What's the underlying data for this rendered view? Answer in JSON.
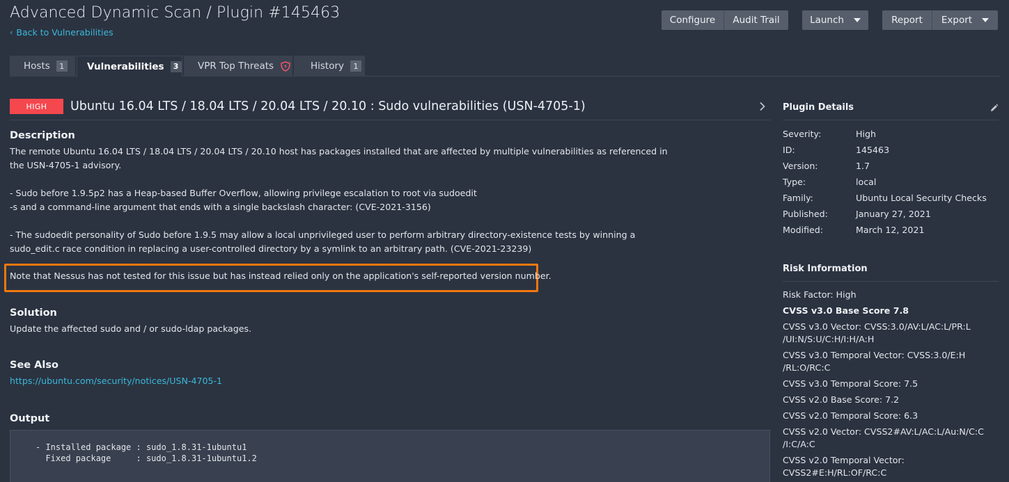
{
  "header": {
    "title": "Advanced Dynamic Scan / Plugin #145463",
    "back_label": "Back to Vulnerabilities"
  },
  "toolbar": {
    "configure": "Configure",
    "audit_trail": "Audit Trail",
    "launch": "Launch",
    "report": "Report",
    "export": "Export"
  },
  "tabs": [
    {
      "label": "Hosts",
      "count": "1"
    },
    {
      "label": "Vulnerabilities",
      "count": "3"
    },
    {
      "label": "VPR Top Threats"
    },
    {
      "label": "History",
      "count": "1"
    }
  ],
  "plugin": {
    "severity": "HIGH",
    "title": "Ubuntu 16.04 LTS / 18.04 LTS / 20.04 LTS / 20.10 : Sudo vulnerabilities (USN-4705-1)"
  },
  "description": {
    "heading": "Description",
    "p1_l1": "The remote Ubuntu 16.04 LTS / 18.04 LTS / 20.04 LTS / 20.10 host has packages installed that are affected by multiple vulnerabilities as referenced in",
    "p1_l2": "the USN-4705-1 advisory.",
    "p2_l1": "- Sudo before 1.9.5p2 has a Heap-based Buffer Overflow, allowing privilege escalation to root via sudoedit",
    "p2_l2": "-s and a command-line argument that ends with a single backslash character: (CVE-2021-3156)",
    "p3_l1": "- The sudoedit personality of Sudo before 1.9.5 may allow a local unprivileged user to perform arbitrary directory-existence tests by winning a",
    "p3_l2": "sudo_edit.c race condition in replacing a user-controlled directory by a symlink to an arbitrary path. (CVE-2021-23239)",
    "note": "Note that Nessus has not tested for this issue but has instead relied only on the application's self-reported version number."
  },
  "solution": {
    "heading": "Solution",
    "text": "Update the affected sudo and / or sudo-ldap packages."
  },
  "see_also": {
    "heading": "See Also",
    "link": "https://ubuntu.com/security/notices/USN-4705-1"
  },
  "output": {
    "heading": "Output",
    "line1": "- Installed package : sudo_1.8.31-1ubuntu1",
    "line2": "  Fixed package     : sudo_1.8.31-1ubuntu1.2"
  },
  "plugin_details": {
    "heading": "Plugin Details",
    "rows": [
      {
        "label": "Severity:",
        "value": "High"
      },
      {
        "label": "ID:",
        "value": "145463"
      },
      {
        "label": "Version:",
        "value": "1.7"
      },
      {
        "label": "Type:",
        "value": "local"
      },
      {
        "label": "Family:",
        "value": "Ubuntu Local Security Checks"
      },
      {
        "label": "Published:",
        "value": "January 27, 2021"
      },
      {
        "label": "Modified:",
        "value": "March 12, 2021"
      }
    ]
  },
  "risk_information": {
    "heading": "Risk Information",
    "risk_factor": "Risk Factor: High",
    "cvss3_base": "CVSS v3.0 Base Score 7.8",
    "cvss3_vector_l1": "CVSS v3.0 Vector: CVSS:3.0/AV:L/AC:L/PR:L",
    "cvss3_vector_l2": "/UI:N/S:U/C:H/I:H/A:H",
    "cvss3_temporal_vector_l1": "CVSS v3.0 Temporal Vector: CVSS:3.0/E:H",
    "cvss3_temporal_vector_l2": "/RL:O/RC:C",
    "cvss3_temporal_score": "CVSS v3.0 Temporal Score: 7.5",
    "cvss2_base": "CVSS v2.0 Base Score: 7.2",
    "cvss2_temporal_score": "CVSS v2.0 Temporal Score: 6.3",
    "cvss2_vector_l1": "CVSS v2.0 Vector: CVSS2#AV:L/AC:L/Au:N/C:C",
    "cvss2_vector_l2": "/I:C/A:C",
    "cvss2_temporal_vector_l1": "CVSS v2.0 Temporal Vector:",
    "cvss2_temporal_vector_l2": "CVSS2#E:H/RL:OF/RC:C"
  },
  "colors": {
    "background": "#2b3341",
    "accent_link": "#3bb8d9",
    "severity_high": "#f5474e",
    "highlight_box": "#f2780d"
  }
}
